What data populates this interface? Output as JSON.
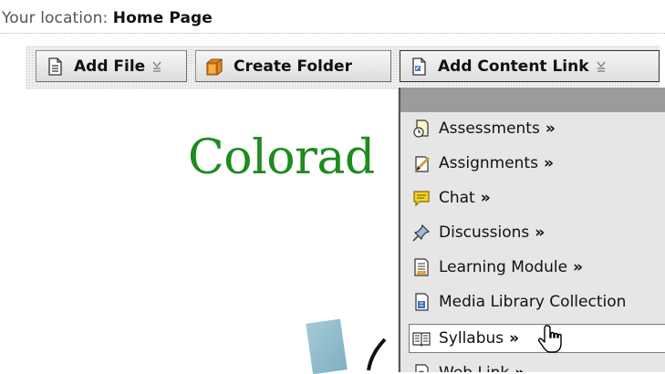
{
  "location": {
    "label": "Your location:",
    "value": "Home Page"
  },
  "toolbar": {
    "add_file": "Add File",
    "create_folder": "Create Folder",
    "add_content_link": "Add Content Link"
  },
  "page": {
    "title": "Colorad"
  },
  "menu": {
    "items": [
      {
        "label": "Assessments",
        "icon": "assessment-icon",
        "arrow": "»"
      },
      {
        "label": "Assignments",
        "icon": "assignment-icon",
        "arrow": "»"
      },
      {
        "label": "Chat",
        "icon": "chat-icon",
        "arrow": "»"
      },
      {
        "label": "Discussions",
        "icon": "discussion-pin-icon",
        "arrow": "»"
      },
      {
        "label": "Learning Module",
        "icon": "learning-module-icon",
        "arrow": "»"
      },
      {
        "label": "Media Library Collection",
        "icon": "media-library-icon",
        "arrow": ""
      },
      {
        "label": "Syllabus",
        "icon": "syllabus-icon",
        "arrow": "»"
      },
      {
        "label": "Web Link",
        "icon": "web-link-icon",
        "arrow": "»"
      }
    ]
  },
  "colors": {
    "title_green": "#1e8b1e",
    "menu_header": "#9b9b9b",
    "menu_bg": "#e6e6e6"
  }
}
